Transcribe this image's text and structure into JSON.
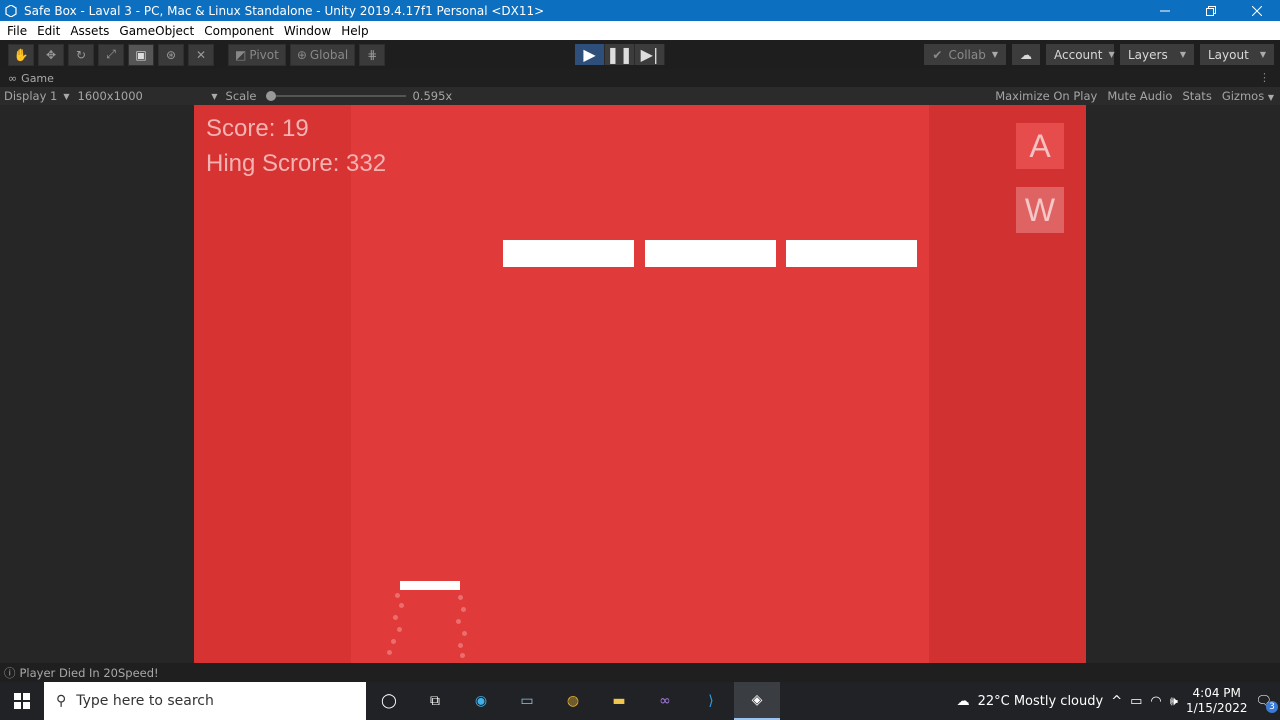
{
  "window": {
    "title": "Safe Box - Laval 3 - PC, Mac & Linux Standalone - Unity 2019.4.17f1 Personal <DX11>"
  },
  "menu": [
    "File",
    "Edit",
    "Assets",
    "GameObject",
    "Component",
    "Window",
    "Help"
  ],
  "toolbar": {
    "pivot_label": "Pivot",
    "global_label": "Global",
    "collab_label": "Collab",
    "account_label": "Account",
    "layers_label": "Layers",
    "layout_label": "Layout"
  },
  "game_tab": {
    "label": "Game"
  },
  "game_bar": {
    "display": "Display 1",
    "resolution": "1600x1000",
    "scale_label": "Scale",
    "scale_value": "0.595x",
    "maximize": "Maximize On Play",
    "mute": "Mute Audio",
    "stats": "Stats",
    "gizmos": "Gizmos"
  },
  "game": {
    "score": "Score: 19",
    "high_score": "Hing Scrore: 332",
    "btn_a": "A",
    "btn_w": "W"
  },
  "status": {
    "message": "Player Died In 20Speed!"
  },
  "taskbar": {
    "search_placeholder": "Type here to search",
    "weather": "22°C  Mostly cloudy",
    "time": "4:04 PM",
    "date": "1/15/2022",
    "notification_count": "3"
  },
  "colors": {
    "game_bg": "#e03a3a",
    "titlebar": "#0d6fbf"
  }
}
